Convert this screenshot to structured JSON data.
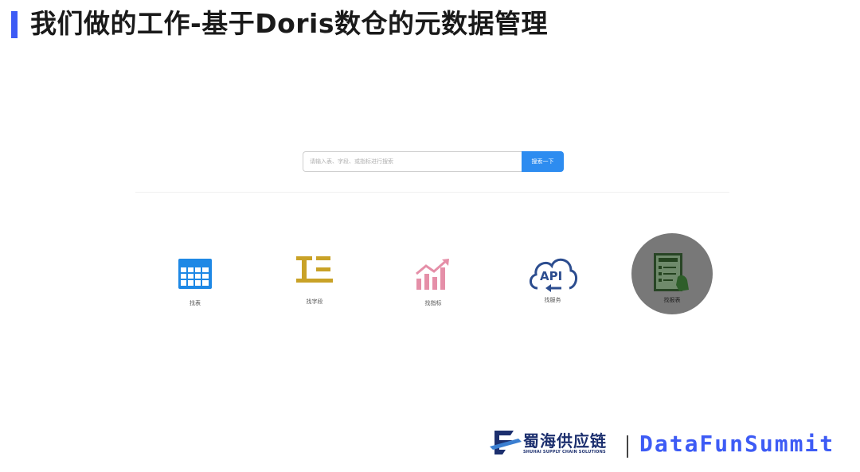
{
  "slide": {
    "title": "我们做的工作-基于Doris数仓的元数据管理",
    "accent_color": "#3D5BF5"
  },
  "search": {
    "placeholder": "请输入表、字段、或指标进行搜索",
    "button_label": "搜索一下",
    "button_color": "#2D8CF0"
  },
  "categories": [
    {
      "label": "找表",
      "icon": "table-grid-icon",
      "color": "#1E88E5"
    },
    {
      "label": "找字段",
      "icon": "field-icon",
      "color": "#C9A227"
    },
    {
      "label": "找指标",
      "icon": "metric-chart-icon",
      "color": "#E58FA8"
    },
    {
      "label": "找服务",
      "icon": "api-cloud-icon",
      "color": "#2C4D8F"
    },
    {
      "label": "找报表",
      "icon": "report-icon",
      "color": "#2E5E2A",
      "highlighted": true
    }
  ],
  "footer": {
    "brand_cn": "蜀海供应链",
    "brand_en": "SHUHAI SUPPLY CHAIN SOLUTIONS",
    "summit": "DataFunSummit"
  }
}
